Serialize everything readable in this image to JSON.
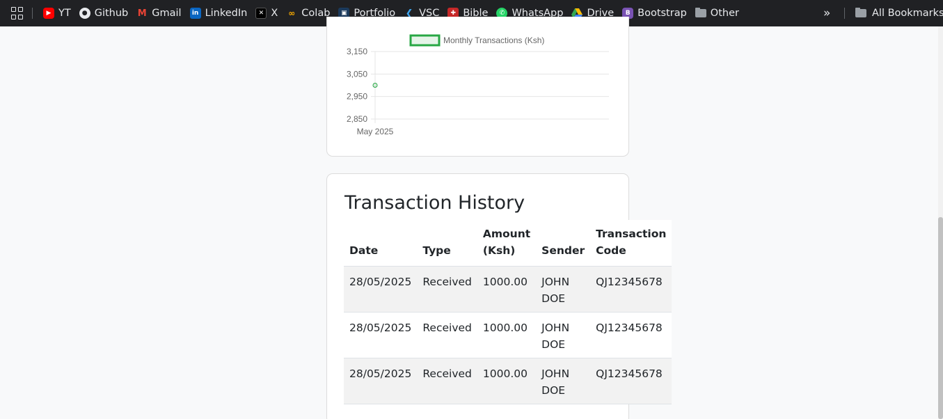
{
  "bookmarks": {
    "items": [
      {
        "label": "YT",
        "icon": "youtube-icon"
      },
      {
        "label": "Github",
        "icon": "github-icon"
      },
      {
        "label": "Gmail",
        "icon": "gmail-icon"
      },
      {
        "label": "LinkedIn",
        "icon": "linkedin-icon"
      },
      {
        "label": "X",
        "icon": "x-icon"
      },
      {
        "label": "Colab",
        "icon": "colab-icon"
      },
      {
        "label": "Portfolio",
        "icon": "portfolio-icon"
      },
      {
        "label": "VSC",
        "icon": "vscode-icon"
      },
      {
        "label": "Bible",
        "icon": "bible-icon"
      },
      {
        "label": "WhatsApp",
        "icon": "whatsapp-icon"
      },
      {
        "label": "Drive",
        "icon": "drive-icon"
      },
      {
        "label": "Bootstrap",
        "icon": "bootstrap-icon"
      },
      {
        "label": "Other",
        "icon": "folder-icon"
      }
    ],
    "more": "»",
    "all_bookmarks": "All Bookmarks"
  },
  "chart_data": {
    "type": "line",
    "legend": [
      "Monthly Transactions (Ksh)"
    ],
    "categories": [
      "May 2025"
    ],
    "series": [
      {
        "name": "Monthly Transactions (Ksh)",
        "values": [
          3000
        ],
        "color": "#28a745"
      }
    ],
    "yticks": [
      "3,150",
      "3,050",
      "2,950",
      "2,850"
    ],
    "ylim": [
      2850,
      3150
    ],
    "grid": true,
    "legend_position": "top"
  },
  "history": {
    "title": "Transaction History",
    "columns": [
      "Date",
      "Type",
      "Amount (Ksh)",
      "Sender",
      "Transaction Code"
    ],
    "rows": [
      [
        "28/05/2025",
        "Received",
        "1000.00",
        "JOHN DOE",
        "QJ12345678"
      ],
      [
        "28/05/2025",
        "Received",
        "1000.00",
        "JOHN DOE",
        "QJ12345678"
      ],
      [
        "28/05/2025",
        "Received",
        "1000.00",
        "JOHN DOE",
        "QJ12345678"
      ]
    ]
  },
  "colors": {
    "accent": "#28a745",
    "bookmark_bar": "#202124",
    "page_bg": "#f8f9fa"
  }
}
